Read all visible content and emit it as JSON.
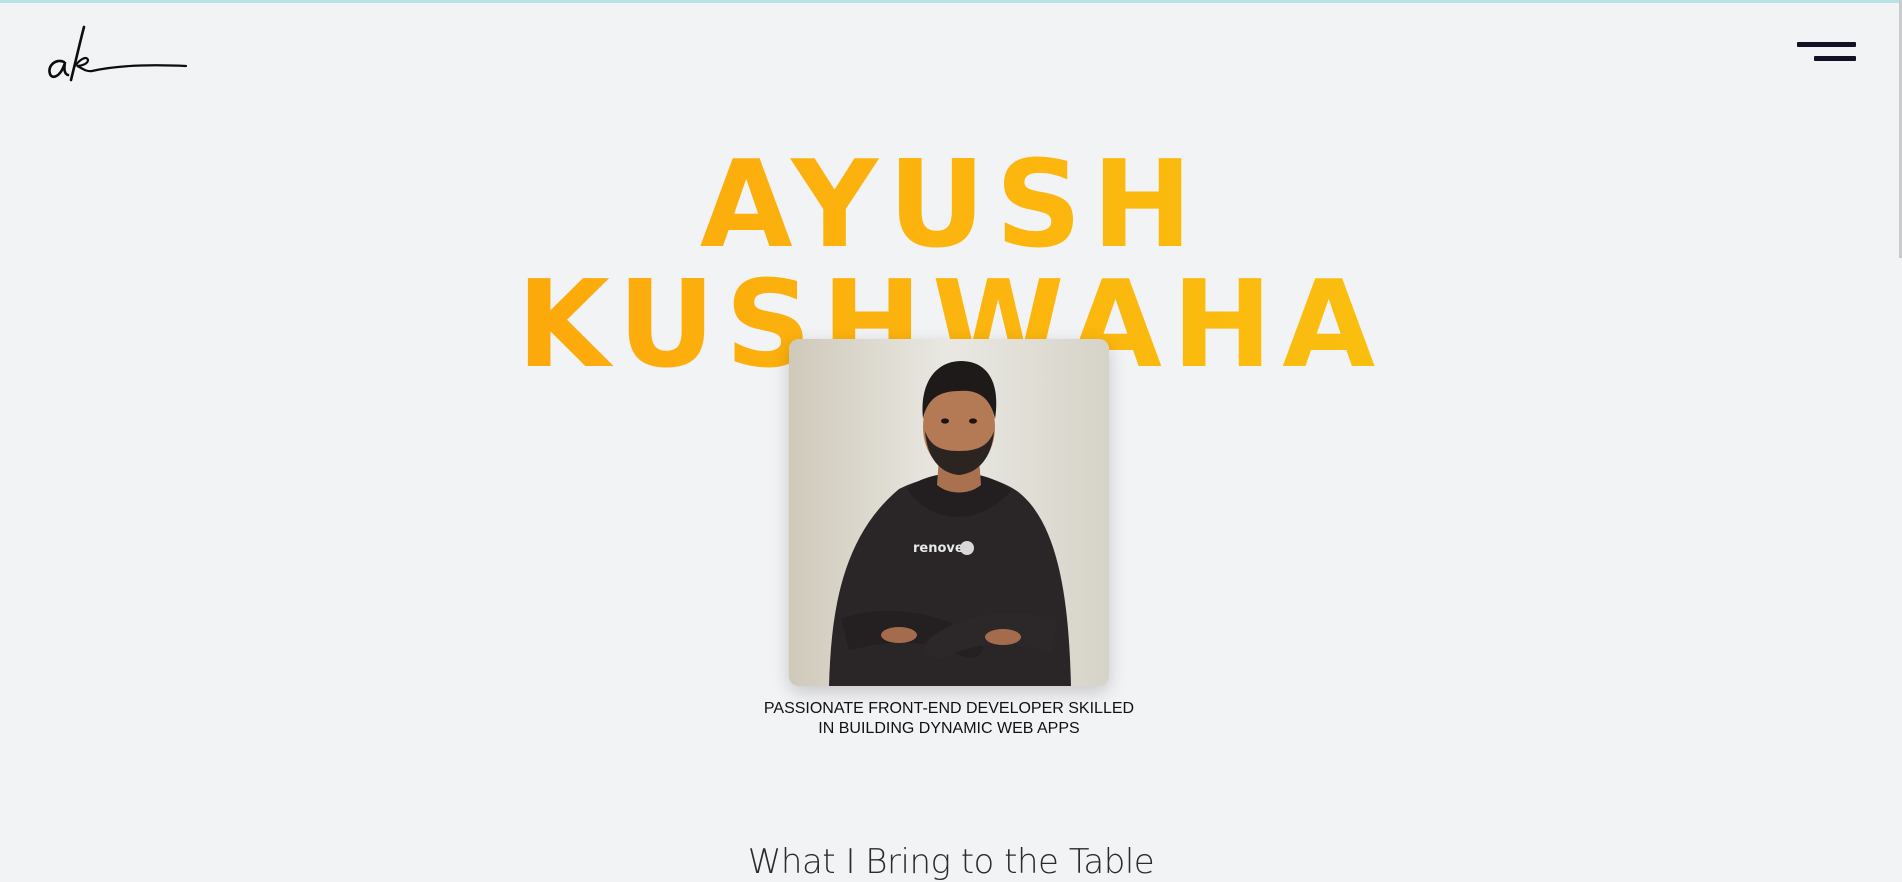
{
  "header": {
    "logo_text": "ak",
    "logo_icon": "signature-logo",
    "menu_icon": "hamburger-menu-icon"
  },
  "hero": {
    "first_name": "AYUSH",
    "last_name": "KUSHWAHA",
    "name_gradient": [
      "#fb9d07",
      "#fcb40e",
      "#f8cb10"
    ],
    "tagline_line1": "PASSIONATE FRONT-END DEVELOPER SKILLED",
    "tagline_line2": "IN BUILDING DYNAMIC WEB APPS",
    "photo_alt": "Portrait of Ayush Kushwaha",
    "shirt_text": "renove"
  },
  "next_section": {
    "title": "What I Bring to the Table"
  },
  "colors": {
    "background": "#f2f3f5",
    "top_accent": "#b8e2e4",
    "menu_bar": "#111127"
  }
}
